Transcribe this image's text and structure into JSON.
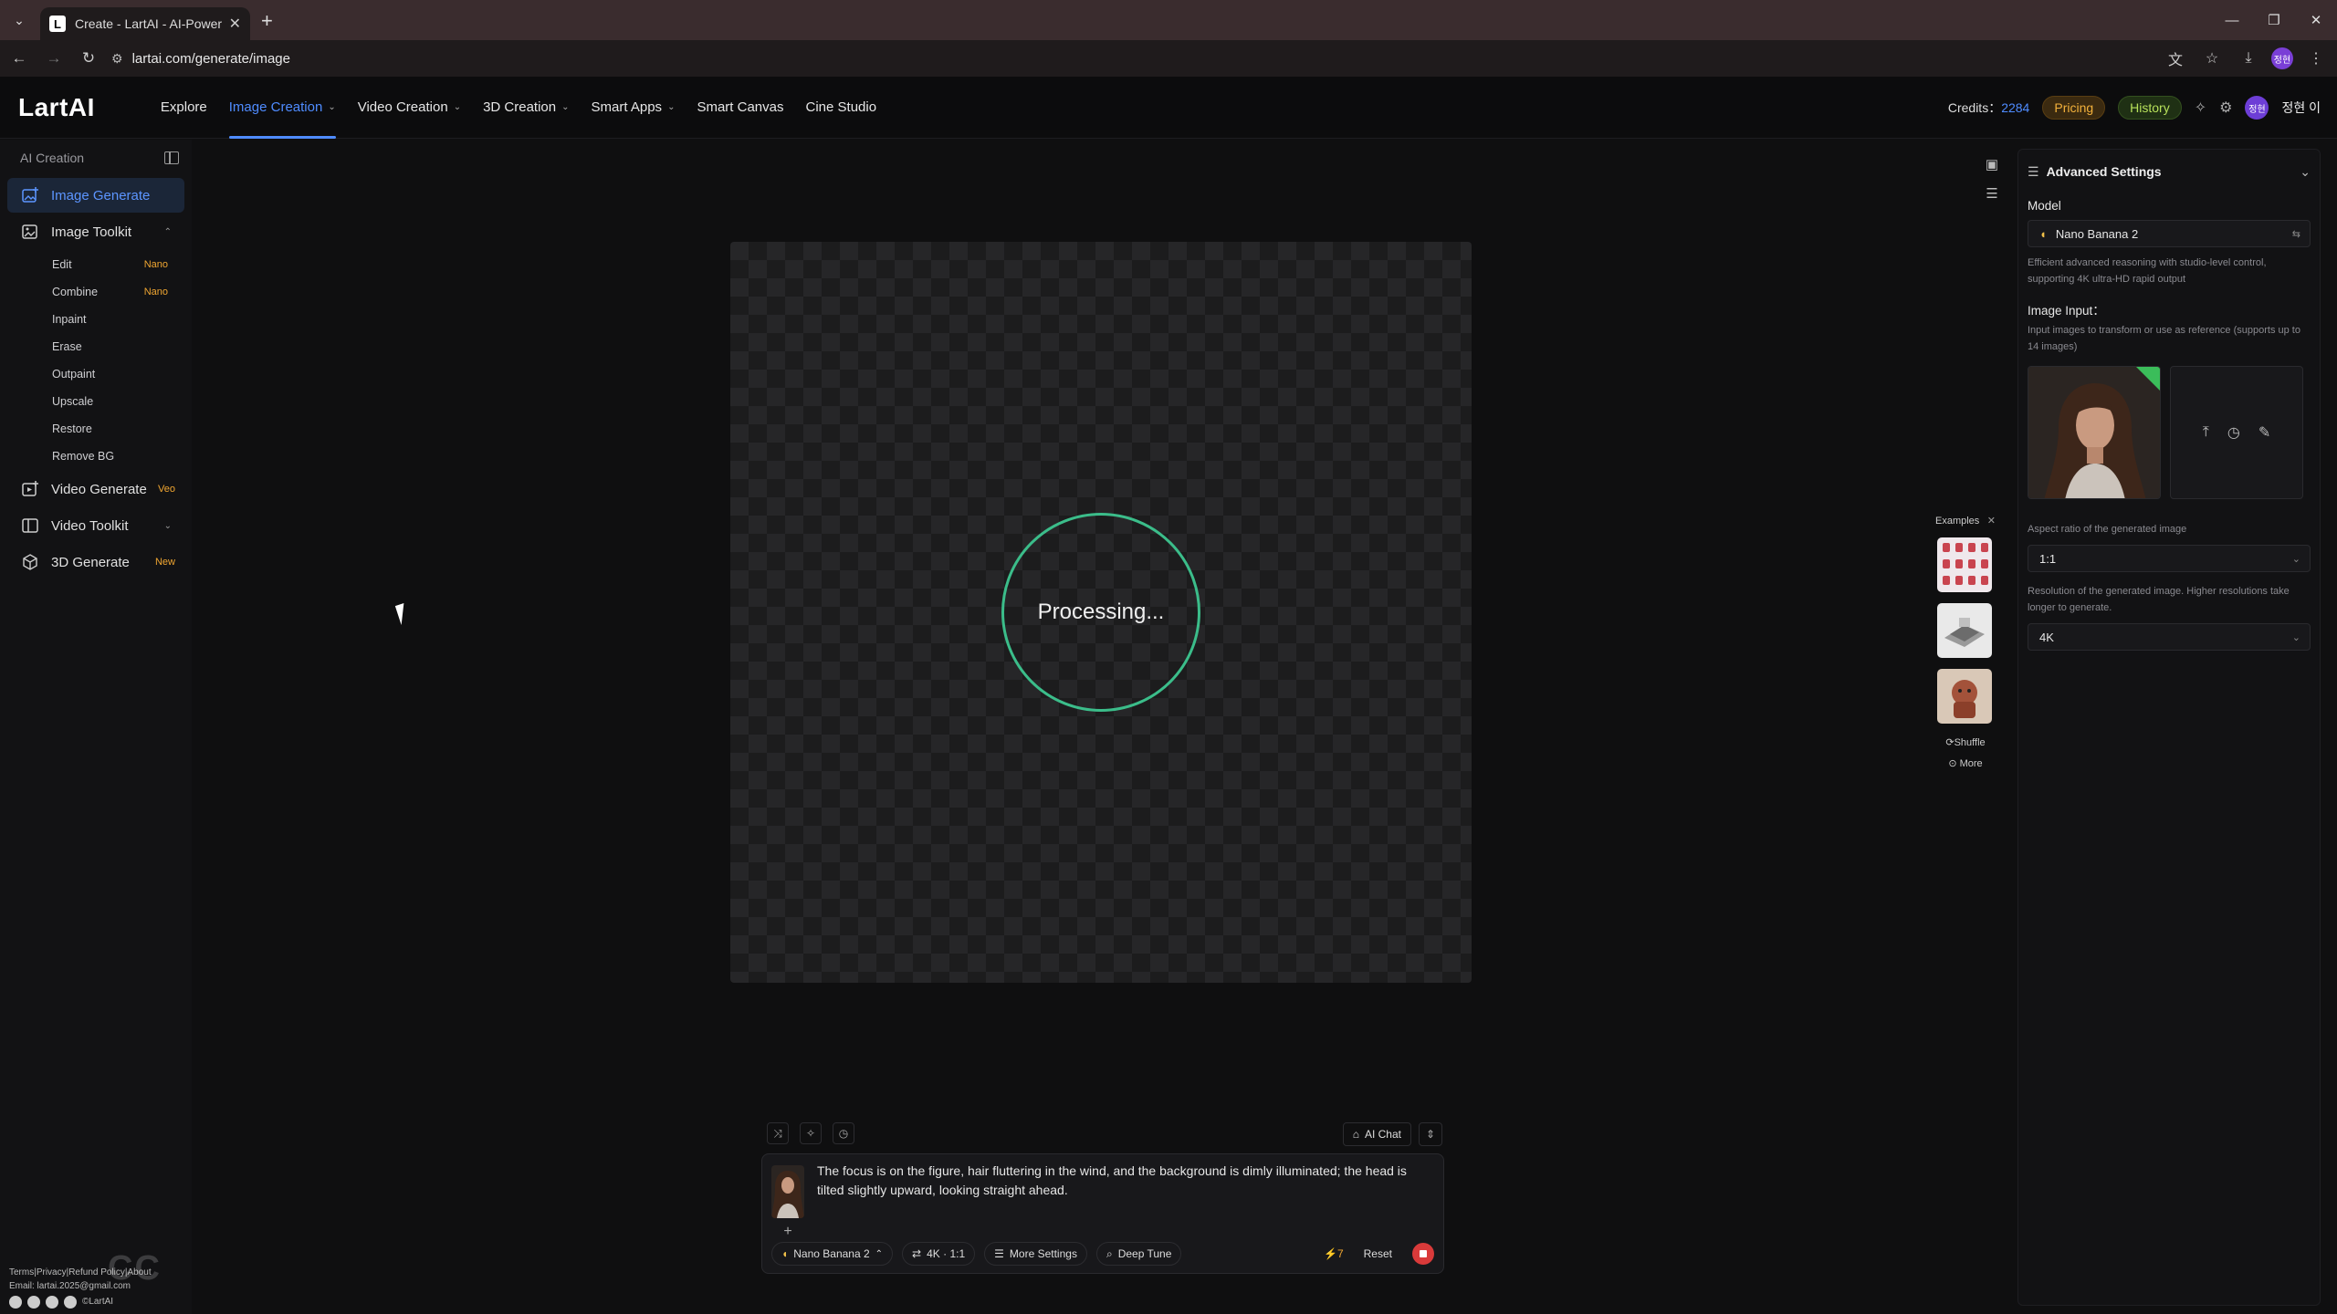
{
  "browser": {
    "tab_title": "Create - LartAI - AI-Powered C",
    "tab_favicon": "L",
    "url": "lartai.com/generate/image",
    "profile_initials": "정현"
  },
  "header": {
    "logo": "LartAI",
    "nav": [
      {
        "label": "Explore",
        "dropdown": false
      },
      {
        "label": "Image Creation",
        "dropdown": true,
        "active": true
      },
      {
        "label": "Video Creation",
        "dropdown": true
      },
      {
        "label": "3D Creation",
        "dropdown": true
      },
      {
        "label": "Smart Apps",
        "dropdown": true
      },
      {
        "label": "Smart Canvas",
        "dropdown": false
      },
      {
        "label": "Cine Studio",
        "dropdown": false
      }
    ],
    "credits_label": "Credits：",
    "credits_value": "2284",
    "pricing": "Pricing",
    "history": "History",
    "avatar_initials": "정현",
    "username": "정현 이",
    "accent_color": "#4f8cff"
  },
  "sidebar": {
    "section_title": "AI Creation",
    "items": [
      {
        "label": "Image Generate",
        "icon": "image-plus-icon",
        "active": true
      },
      {
        "label": "Image Toolkit",
        "icon": "image-edit-icon",
        "expanded": true
      },
      {
        "label": "Video Generate",
        "icon": "video-plus-icon",
        "tag": "Veo"
      },
      {
        "label": "Video Toolkit",
        "icon": "video-edit-icon",
        "expanded": false
      },
      {
        "label": "3D Generate",
        "icon": "cube-icon",
        "tag": "New"
      }
    ],
    "toolkit": [
      {
        "label": "Edit",
        "tag": "Nano"
      },
      {
        "label": "Combine",
        "tag": "Nano"
      },
      {
        "label": "Inpaint",
        "tag": ""
      },
      {
        "label": "Erase",
        "tag": ""
      },
      {
        "label": "Outpaint",
        "tag": ""
      },
      {
        "label": "Upscale",
        "tag": ""
      },
      {
        "label": "Restore",
        "tag": ""
      },
      {
        "label": "Remove BG",
        "tag": ""
      }
    ],
    "footer_links": "Terms|Privacy|Refund Policy|About",
    "footer_email": "Email: lartai.2025@gmail.com",
    "footer_copy": "©LartAI",
    "watermark": "CC"
  },
  "canvas": {
    "status": "Processing...",
    "ring_color": "#3bbd8a"
  },
  "examples": {
    "title": "Examples",
    "close": "✕",
    "shuffle": "Shuffle",
    "more": "More"
  },
  "settings": {
    "title": "Advanced Settings",
    "model_label": "Model",
    "model_value": "Nano Banana 2",
    "model_desc": "Efficient advanced reasoning with studio-level control, supporting 4K ultra-HD rapid output",
    "image_input_label": "Image Input：",
    "image_input_desc": "Input images to transform or use as reference (supports up to 14 images)",
    "aspect_desc": "Aspect ratio of the generated image",
    "aspect_value": "1:1",
    "resolution_desc": "Resolution of the generated image. Higher resolutions take longer to generate.",
    "resolution_value": "4K"
  },
  "prompt": {
    "text": "The focus is on the figure, hair fluttering in the wind, and the background is dimly illuminated; the head is tilted slightly upward, looking straight ahead.",
    "ai_chat": "AI Chat",
    "model_chip": "Nano Banana 2",
    "res_chip": "4K · 1:1",
    "more_settings": "More Settings",
    "deep_tune": "Deep Tune",
    "cost": "7",
    "reset": "Reset"
  }
}
